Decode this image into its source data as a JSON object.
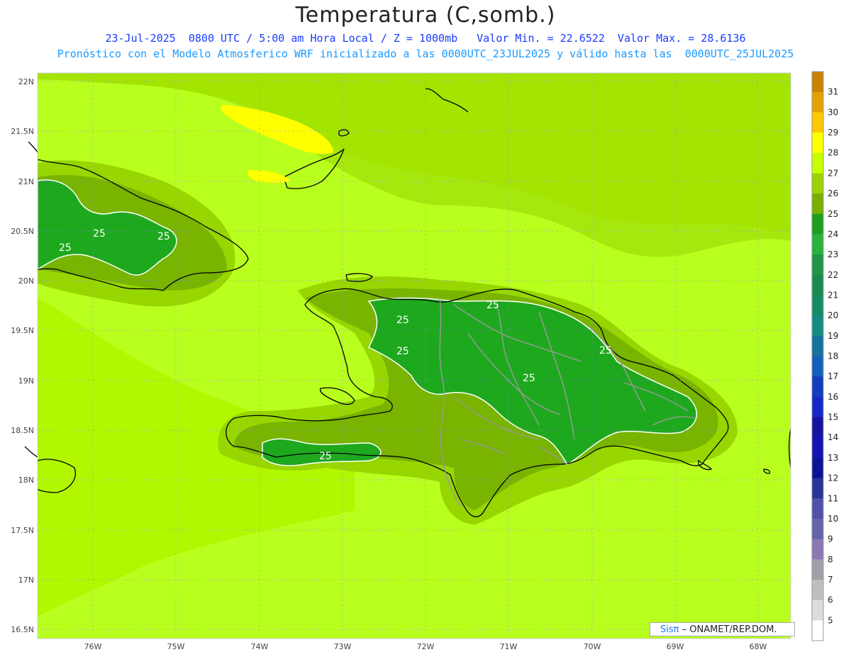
{
  "header": {
    "title": "Temperatura (C,somb.)",
    "line1": "23-Jul-2025  0800 UTC / 5:00 am Hora Local / Z = 1000mb   Valor Min. = 22.6522  Valor Max. = 28.6136",
    "line2": "Pronóstico con el Modelo Atmosferico WRF inicializado a las 0000UTC_23JUL2025 y válido hasta las  0000UTC_25JUL2025"
  },
  "axes": {
    "lat_labels": [
      "22N",
      "21.5N",
      "21N",
      "20.5N",
      "20N",
      "19.5N",
      "19N",
      "18.5N",
      "18N",
      "17.5N",
      "17N",
      "16.5N"
    ],
    "lon_labels": [
      "76W",
      "75W",
      "74W",
      "73W",
      "72W",
      "71W",
      "70W",
      "69W",
      "68W"
    ]
  },
  "colorbar": {
    "labels": [
      "31",
      "30",
      "29",
      "28",
      "27",
      "26",
      "25",
      "24",
      "23",
      "22",
      "21",
      "20",
      "19",
      "18",
      "17",
      "16",
      "15",
      "14",
      "13",
      "12",
      "11",
      "10",
      "9",
      "8",
      "7",
      "6",
      "5"
    ],
    "colors": [
      "#c88200",
      "#e6a000",
      "#ffc800",
      "#ffff00",
      "#c8ff00",
      "#9bd200",
      "#78af00",
      "#1ea01e",
      "#28b43c",
      "#1e9646",
      "#188c50",
      "#148c64",
      "#148c82",
      "#1473a0",
      "#145fbe",
      "#143cbe",
      "#1428c8",
      "#1414a0",
      "#1414b4",
      "#0a1496",
      "#28349b",
      "#5050aa",
      "#6464aa",
      "#8c78b4",
      "#a0a0aa",
      "#bebebe",
      "#dcdcdc",
      "#ffffff"
    ]
  },
  "contour_labels": [
    "25",
    "25",
    "25",
    "25",
    "25",
    "25",
    "25",
    "25",
    "25"
  ],
  "credit": {
    "brand": "Sisπ",
    "org": "– ONAMET/REP.DOM."
  }
}
